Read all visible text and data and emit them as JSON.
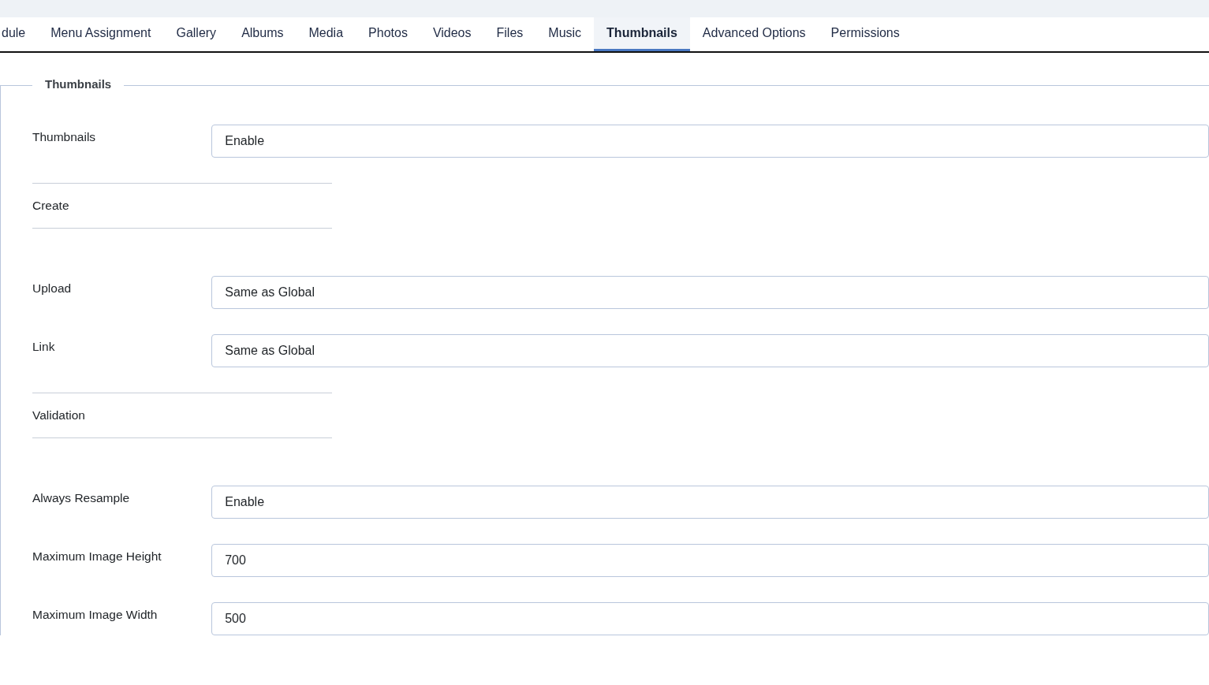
{
  "tabs": [
    {
      "label": "dule",
      "selected": false
    },
    {
      "label": "Menu Assignment",
      "selected": false
    },
    {
      "label": "Gallery",
      "selected": false
    },
    {
      "label": "Albums",
      "selected": false
    },
    {
      "label": "Media",
      "selected": false
    },
    {
      "label": "Photos",
      "selected": false
    },
    {
      "label": "Videos",
      "selected": false
    },
    {
      "label": "Files",
      "selected": false
    },
    {
      "label": "Music",
      "selected": false
    },
    {
      "label": "Thumbnails",
      "selected": true
    },
    {
      "label": "Advanced Options",
      "selected": false
    },
    {
      "label": "Permissions",
      "selected": false
    }
  ],
  "fieldset": {
    "legend": "Thumbnails",
    "rows": [
      {
        "kind": "select",
        "label": "Thumbnails",
        "value": "Enable"
      },
      {
        "kind": "section",
        "label": "Create"
      },
      {
        "kind": "select",
        "label": "Upload",
        "value": "Same as Global"
      },
      {
        "kind": "select",
        "label": "Link",
        "value": "Same as Global"
      },
      {
        "kind": "section",
        "label": "Validation"
      },
      {
        "kind": "select",
        "label": "Always Resample",
        "value": "Enable"
      },
      {
        "kind": "text",
        "label": "Maximum Image Height",
        "value": "700"
      },
      {
        "kind": "text",
        "label": "Maximum Image Width",
        "value": "500"
      }
    ]
  }
}
